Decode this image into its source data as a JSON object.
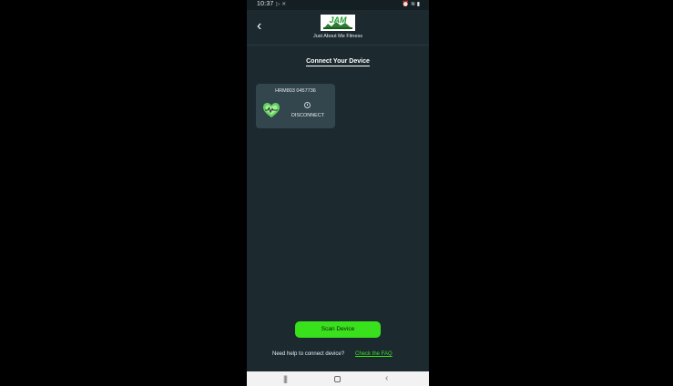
{
  "status_bar": {
    "time": "10:37",
    "left_icons": "▷ ✕",
    "right_icons": "⏰ ≋ ▮"
  },
  "header": {
    "back_icon": "‹",
    "logo_text": "JAM",
    "brand_name": "Just About Me Fitness"
  },
  "main": {
    "section_title": "Connect Your Device",
    "device": {
      "name": "HRM803 0457736",
      "action_label": "DISCONNECT"
    },
    "scan_button_label": "Scan Device",
    "help_text": "Need help to connect device?",
    "faq_link_label": "Check the FAQ"
  },
  "nav_bar": {
    "recents_icon": "|||",
    "back_icon": "‹"
  },
  "colors": {
    "background": "#1c2a30",
    "card": "#33454d",
    "accent_green": "#39e01c"
  }
}
